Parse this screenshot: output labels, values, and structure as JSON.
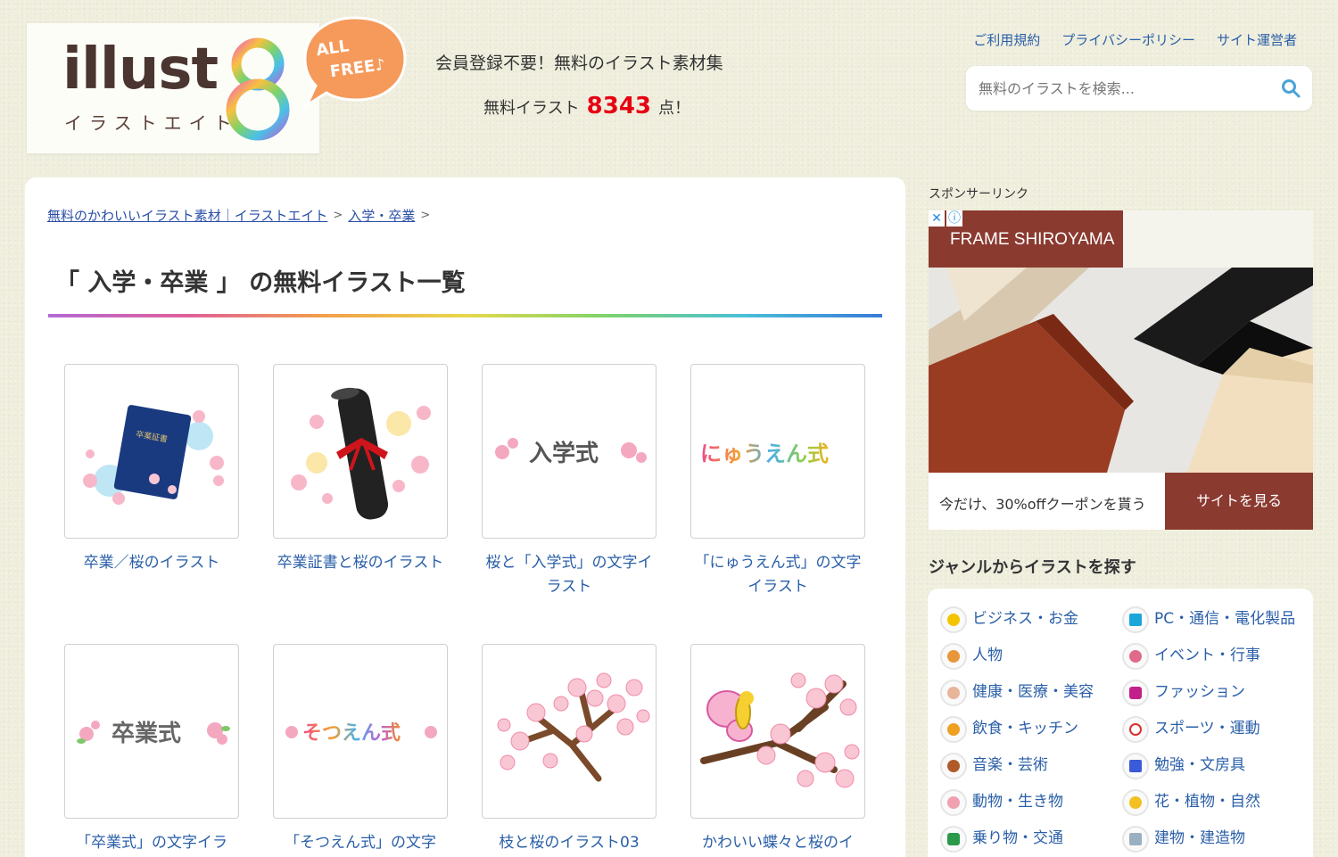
{
  "header": {
    "logo_word": "illust",
    "logo_kana": "イラストエイト",
    "bubble_line1": "ALL",
    "bubble_line2": "FREE♪",
    "tagline": "会員登録不要！無料のイラスト素材集",
    "count_prefix": "無料イラスト",
    "count_value": "8343",
    "count_suffix": "点！",
    "links": [
      "ご利用規約",
      "プライバシーポリシー",
      "サイト運営者"
    ],
    "search_placeholder": "無料のイラストを検索..."
  },
  "breadcrumb": {
    "home": "無料のかわいいイラスト素材｜イラストエイト",
    "current": "入学・卒業",
    "separator": ">"
  },
  "page_title": "「 入学・卒業 」 の無料イラスト一覧",
  "cards": [
    {
      "title": "卒業／桜のイラスト",
      "icon": "diploma-folder-icon"
    },
    {
      "title": "卒業証書と桜のイラスト",
      "icon": "diploma-scroll-icon"
    },
    {
      "title": "桜と「入学式」の文字イラスト",
      "icon": "entrance-ceremony-text-icon",
      "art_text": "入学式"
    },
    {
      "title": "「にゅうえん式」の文字イラスト",
      "icon": "nyuuen-text-icon",
      "art_text": "にゅうえん式"
    },
    {
      "title": "「卒業式」の文字イラ",
      "icon": "graduation-text-icon",
      "art_text": "卒業式"
    },
    {
      "title": "「そつえん式」の文字",
      "icon": "sotsuen-text-icon",
      "art_text": "そつえん式"
    },
    {
      "title": "枝と桜のイラスト03",
      "icon": "cherry-branch-icon"
    },
    {
      "title": "かわいい蝶々と桜のイ",
      "icon": "butterfly-cherry-icon"
    }
  ],
  "diploma_label": "卒業証書",
  "sidebar": {
    "sponsor_label": "スポンサーリンク",
    "ad": {
      "brand": "FRAME SHIROYAMA",
      "text": "今だけ、30%offクーポンを貰う",
      "button": "サイトを見る",
      "close_glyph": "✕",
      "info_glyph": "ⓘ"
    },
    "genre_heading": "ジャンルからイラストを探す",
    "genres": [
      {
        "label": "ビジネス・お金",
        "color": "#f5c400"
      },
      {
        "label": "PC・通信・電化製品",
        "color": "#1aa7d8"
      },
      {
        "label": "人物",
        "color": "#e8963a"
      },
      {
        "label": "イベント・行事",
        "color": "#e06a8a"
      },
      {
        "label": "健康・医療・美容",
        "color": "#e8b49a"
      },
      {
        "label": "ファッション",
        "color": "#c2208a"
      },
      {
        "label": "飲食・キッチン",
        "color": "#f0a020"
      },
      {
        "label": "スポーツ・運動",
        "color": "#d83030"
      },
      {
        "label": "音楽・芸術",
        "color": "#b05a2a"
      },
      {
        "label": "勉強・文房具",
        "color": "#3a5ad8"
      },
      {
        "label": "動物・生き物",
        "color": "#f0a0b0"
      },
      {
        "label": "花・植物・自然",
        "color": "#f2c020"
      },
      {
        "label": "乗り物・交通",
        "color": "#2a9a4a"
      },
      {
        "label": "建物・建造物",
        "color": "#9ab0c0"
      }
    ]
  }
}
